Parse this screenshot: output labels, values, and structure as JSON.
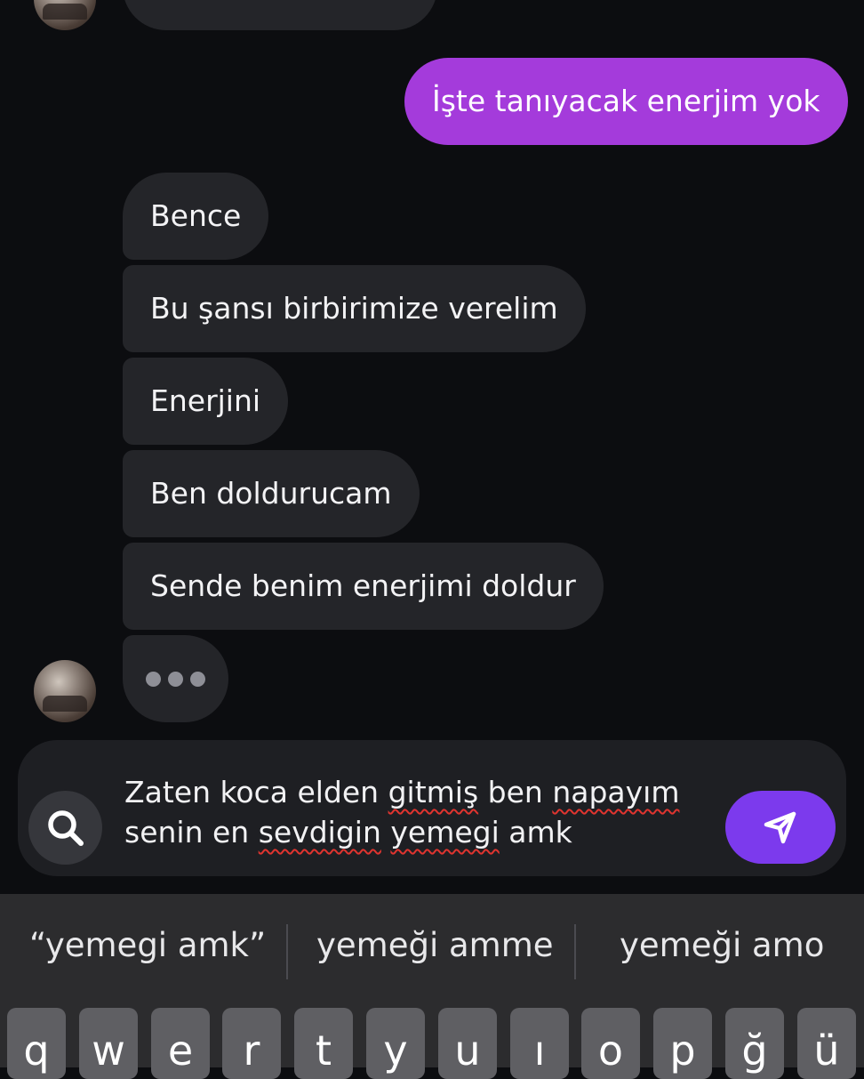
{
  "messages": {
    "outgoing_1": "İşte tanıyacak enerjim yok",
    "incoming_1": "Bence",
    "incoming_2": "Bu şansı birbirimize verelim",
    "incoming_3": "Enerjini",
    "incoming_4": "Ben doldurucam",
    "incoming_5": "Sende benim enerjimi doldur"
  },
  "composer": {
    "line1_a": "Zaten koca elden ",
    "line1_b": "gitmiş",
    "line1_c": " ben ",
    "line1_d": "napayım",
    "line2_a": "senin en ",
    "line2_b": "sevdigin",
    "line2_c": " ",
    "line2_d": "yemegi",
    "line2_e": " amk"
  },
  "keyboard": {
    "suggestions": [
      "“yemegi amk”",
      "yemeği amme",
      "yemeği amo"
    ],
    "keys": [
      "q",
      "w",
      "e",
      "r",
      "t",
      "y",
      "u",
      "ı",
      "o",
      "p",
      "ğ",
      "ü"
    ]
  },
  "colors": {
    "outgoing_bubble": "#a43bdb",
    "incoming_bubble": "#242529",
    "send_button": "#7c3aed",
    "background": "#0c0d10"
  },
  "icons": {
    "search": "search-icon",
    "send": "send-icon",
    "typing": "typing-indicator"
  }
}
